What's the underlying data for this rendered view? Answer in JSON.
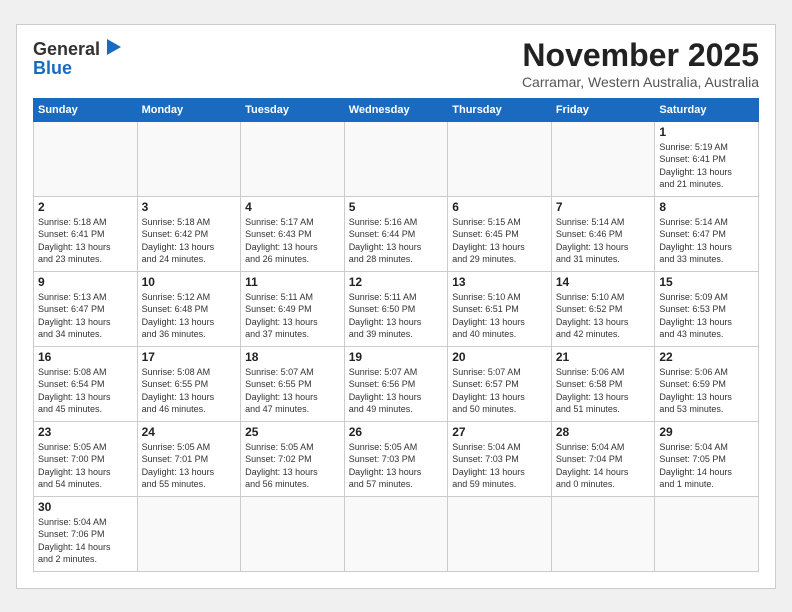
{
  "header": {
    "logo_general": "General",
    "logo_blue": "Blue",
    "month_title": "November 2025",
    "location": "Carramar, Western Australia, Australia"
  },
  "weekdays": [
    "Sunday",
    "Monday",
    "Tuesday",
    "Wednesday",
    "Thursday",
    "Friday",
    "Saturday"
  ],
  "days": [
    {
      "date": "",
      "info": ""
    },
    {
      "date": "",
      "info": ""
    },
    {
      "date": "",
      "info": ""
    },
    {
      "date": "",
      "info": ""
    },
    {
      "date": "",
      "info": ""
    },
    {
      "date": "",
      "info": ""
    },
    {
      "date": "1",
      "info": "Sunrise: 5:19 AM\nSunset: 6:41 PM\nDaylight: 13 hours\nand 21 minutes."
    },
    {
      "date": "2",
      "info": "Sunrise: 5:18 AM\nSunset: 6:41 PM\nDaylight: 13 hours\nand 23 minutes."
    },
    {
      "date": "3",
      "info": "Sunrise: 5:18 AM\nSunset: 6:42 PM\nDaylight: 13 hours\nand 24 minutes."
    },
    {
      "date": "4",
      "info": "Sunrise: 5:17 AM\nSunset: 6:43 PM\nDaylight: 13 hours\nand 26 minutes."
    },
    {
      "date": "5",
      "info": "Sunrise: 5:16 AM\nSunset: 6:44 PM\nDaylight: 13 hours\nand 28 minutes."
    },
    {
      "date": "6",
      "info": "Sunrise: 5:15 AM\nSunset: 6:45 PM\nDaylight: 13 hours\nand 29 minutes."
    },
    {
      "date": "7",
      "info": "Sunrise: 5:14 AM\nSunset: 6:46 PM\nDaylight: 13 hours\nand 31 minutes."
    },
    {
      "date": "8",
      "info": "Sunrise: 5:14 AM\nSunset: 6:47 PM\nDaylight: 13 hours\nand 33 minutes."
    },
    {
      "date": "9",
      "info": "Sunrise: 5:13 AM\nSunset: 6:47 PM\nDaylight: 13 hours\nand 34 minutes."
    },
    {
      "date": "10",
      "info": "Sunrise: 5:12 AM\nSunset: 6:48 PM\nDaylight: 13 hours\nand 36 minutes."
    },
    {
      "date": "11",
      "info": "Sunrise: 5:11 AM\nSunset: 6:49 PM\nDaylight: 13 hours\nand 37 minutes."
    },
    {
      "date": "12",
      "info": "Sunrise: 5:11 AM\nSunset: 6:50 PM\nDaylight: 13 hours\nand 39 minutes."
    },
    {
      "date": "13",
      "info": "Sunrise: 5:10 AM\nSunset: 6:51 PM\nDaylight: 13 hours\nand 40 minutes."
    },
    {
      "date": "14",
      "info": "Sunrise: 5:10 AM\nSunset: 6:52 PM\nDaylight: 13 hours\nand 42 minutes."
    },
    {
      "date": "15",
      "info": "Sunrise: 5:09 AM\nSunset: 6:53 PM\nDaylight: 13 hours\nand 43 minutes."
    },
    {
      "date": "16",
      "info": "Sunrise: 5:08 AM\nSunset: 6:54 PM\nDaylight: 13 hours\nand 45 minutes."
    },
    {
      "date": "17",
      "info": "Sunrise: 5:08 AM\nSunset: 6:55 PM\nDaylight: 13 hours\nand 46 minutes."
    },
    {
      "date": "18",
      "info": "Sunrise: 5:07 AM\nSunset: 6:55 PM\nDaylight: 13 hours\nand 47 minutes."
    },
    {
      "date": "19",
      "info": "Sunrise: 5:07 AM\nSunset: 6:56 PM\nDaylight: 13 hours\nand 49 minutes."
    },
    {
      "date": "20",
      "info": "Sunrise: 5:07 AM\nSunset: 6:57 PM\nDaylight: 13 hours\nand 50 minutes."
    },
    {
      "date": "21",
      "info": "Sunrise: 5:06 AM\nSunset: 6:58 PM\nDaylight: 13 hours\nand 51 minutes."
    },
    {
      "date": "22",
      "info": "Sunrise: 5:06 AM\nSunset: 6:59 PM\nDaylight: 13 hours\nand 53 minutes."
    },
    {
      "date": "23",
      "info": "Sunrise: 5:05 AM\nSunset: 7:00 PM\nDaylight: 13 hours\nand 54 minutes."
    },
    {
      "date": "24",
      "info": "Sunrise: 5:05 AM\nSunset: 7:01 PM\nDaylight: 13 hours\nand 55 minutes."
    },
    {
      "date": "25",
      "info": "Sunrise: 5:05 AM\nSunset: 7:02 PM\nDaylight: 13 hours\nand 56 minutes."
    },
    {
      "date": "26",
      "info": "Sunrise: 5:05 AM\nSunset: 7:03 PM\nDaylight: 13 hours\nand 57 minutes."
    },
    {
      "date": "27",
      "info": "Sunrise: 5:04 AM\nSunset: 7:03 PM\nDaylight: 13 hours\nand 59 minutes."
    },
    {
      "date": "28",
      "info": "Sunrise: 5:04 AM\nSunset: 7:04 PM\nDaylight: 14 hours\nand 0 minutes."
    },
    {
      "date": "29",
      "info": "Sunrise: 5:04 AM\nSunset: 7:05 PM\nDaylight: 14 hours\nand 1 minute."
    },
    {
      "date": "30",
      "info": "Sunrise: 5:04 AM\nSunset: 7:06 PM\nDaylight: 14 hours\nand 2 minutes."
    },
    {
      "date": "",
      "info": ""
    },
    {
      "date": "",
      "info": ""
    },
    {
      "date": "",
      "info": ""
    },
    {
      "date": "",
      "info": ""
    },
    {
      "date": "",
      "info": ""
    },
    {
      "date": "",
      "info": ""
    }
  ]
}
